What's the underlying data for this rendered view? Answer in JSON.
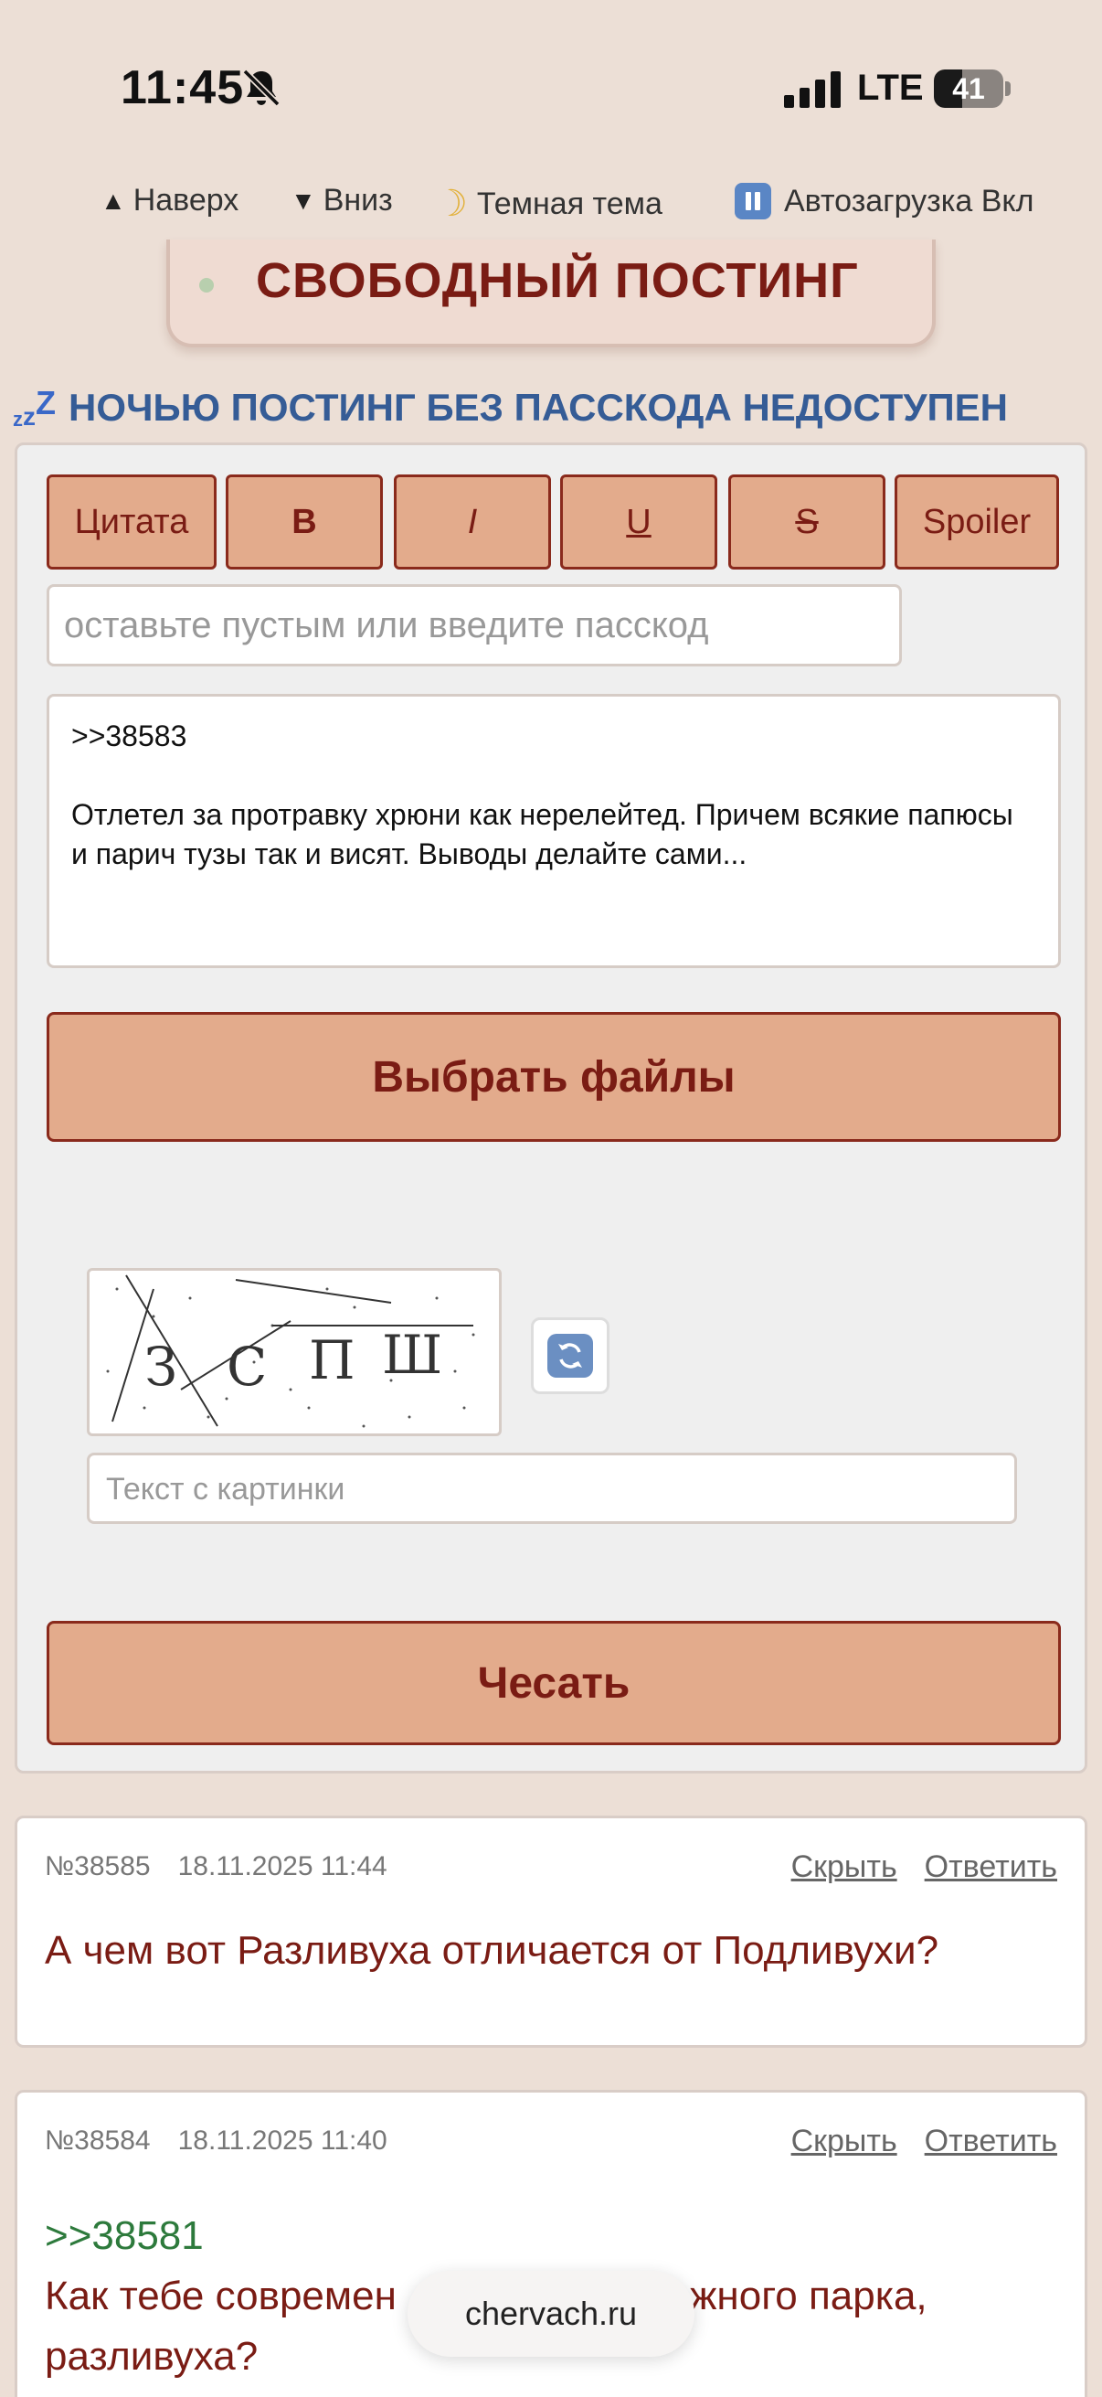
{
  "status_bar": {
    "time": "11:45",
    "network": "LTE",
    "battery": "41"
  },
  "topnav": {
    "up": "Наверх",
    "down": "Вниз",
    "dark_theme": "Темная тема",
    "autoload": "Автозагрузка Вкл"
  },
  "banner": {
    "title": "СВОБОДНЫЙ ПОСТИНГ"
  },
  "warning": {
    "zzz": [
      "z",
      "z",
      "Z"
    ],
    "text": "НОЧЬЮ ПОСТИНГ БЕЗ ПАССКОДА НЕДОСТУПЕН"
  },
  "form": {
    "format_buttons": {
      "quote": "Цитата",
      "bold": "B",
      "italic": "I",
      "underline": "U",
      "strike": "S",
      "spoiler": "Spoiler"
    },
    "passcode_placeholder": "оставьте пустым или введите пасскод",
    "message": {
      "reply_ref": ">>38583",
      "text": "Отлетел за протравку хрюни как нерелейтед. Причем всякие папюсы и парич тузы так и висят. Выводы делайте сами..."
    },
    "choose_files": "Выбрать файлы",
    "captcha": {
      "letters": [
        "З",
        "С",
        "П",
        "Ш"
      ]
    },
    "captcha_placeholder": "Текст с картинки",
    "submit": "Чесать"
  },
  "posts": [
    {
      "number": "№38585",
      "date": "18.11.2025 11:44",
      "hide": "Скрыть",
      "reply": "Ответить",
      "text": "А чем вот Разливуха отличается от Подливухи?"
    },
    {
      "number": "№38584",
      "date": "18.11.2025 11:40",
      "hide": "Скрыть",
      "reply": "Ответить",
      "reply_ref": ">>38581",
      "text": "Как тебе современ",
      "text_tail": "жного парка,",
      "text_line2": "разливуха?"
    }
  ],
  "browser": {
    "url": "chervach.ru"
  },
  "colors": {
    "background": "#ecdfd6",
    "accent": "#7a1c14",
    "button": "#e3ab8c",
    "reply_link": "#2d7a3c",
    "warning_blue": "#355c96"
  }
}
